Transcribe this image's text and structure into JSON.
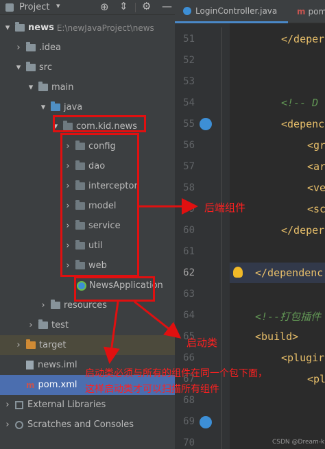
{
  "header": {
    "title": "Project"
  },
  "tabs": [
    {
      "label": "LoginController.java"
    },
    {
      "label": "pom"
    }
  ],
  "tree": {
    "root_name": "news",
    "root_path": "E:\\newJavaProject\\news",
    "items": [
      {
        "label": ".idea"
      },
      {
        "label": "src"
      },
      {
        "label": "main"
      },
      {
        "label": "java"
      },
      {
        "label": "com.kid.news"
      },
      {
        "label": "config"
      },
      {
        "label": "dao"
      },
      {
        "label": "interceptor"
      },
      {
        "label": "model"
      },
      {
        "label": "service"
      },
      {
        "label": "util"
      },
      {
        "label": "web"
      },
      {
        "label": "NewsApplication"
      },
      {
        "label": "resources"
      },
      {
        "label": "test"
      },
      {
        "label": "target"
      },
      {
        "label": "news.iml"
      },
      {
        "label": "pom.xml"
      },
      {
        "label": "External Libraries"
      },
      {
        "label": "Scratches and Consoles"
      }
    ]
  },
  "editor": {
    "line_numbers": [
      "51",
      "52",
      "53",
      "54",
      "55",
      "56",
      "57",
      "58",
      "59",
      "60",
      "61",
      "62",
      "63",
      "64",
      "65",
      "66",
      "67",
      "68",
      "69",
      "70"
    ],
    "lines": [
      {
        "text": "</deper"
      },
      {
        "text": "<!--  D"
      },
      {
        "text": "<depenc"
      },
      {
        "text": "<gr"
      },
      {
        "text": "<ar"
      },
      {
        "text": "<ve"
      },
      {
        "text": "<sc"
      },
      {
        "text": "</deper"
      },
      {
        "text": "</dependenc"
      },
      {
        "text": "<!--打包插件"
      },
      {
        "text": "<build>"
      },
      {
        "text": "<plugir"
      },
      {
        "text": "<pl"
      }
    ]
  },
  "annotations": {
    "backend": "后端组件",
    "startup": "启动类",
    "note_line1": "启动类必须与所有的组件在同一个包下面，",
    "note_line2": "这样启动类才可以扫描所有组件",
    "watermark": "CSDN @Dream-kid"
  }
}
